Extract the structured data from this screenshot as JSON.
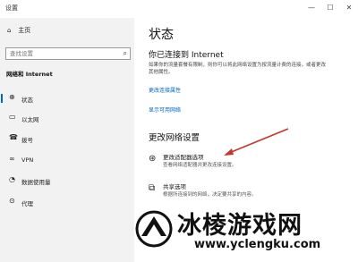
{
  "window": {
    "title": "设置",
    "minimize": "—",
    "maximize": "☐",
    "close": "✕"
  },
  "sidebar": {
    "home": {
      "icon": "home-icon",
      "glyph": "⌂",
      "label": "主页"
    },
    "search": {
      "placeholder": "查找设置",
      "icon": "search-icon",
      "glyph": "⌕"
    },
    "section": "网络和 Internet",
    "items": [
      {
        "icon": "status-icon",
        "glyph": "⊕",
        "label": "状态"
      },
      {
        "icon": "ethernet-icon",
        "glyph": "▭",
        "label": "以太网"
      },
      {
        "icon": "dialup-icon",
        "glyph": "☎",
        "label": "拨号"
      },
      {
        "icon": "vpn-icon",
        "glyph": "∞",
        "label": "VPN"
      },
      {
        "icon": "data-usage-icon",
        "glyph": "◔",
        "label": "数据使用量"
      },
      {
        "icon": "proxy-icon",
        "glyph": "⊙",
        "label": "代理"
      }
    ]
  },
  "main": {
    "title": "状态",
    "connected_heading": "你已连接到 Internet",
    "connected_desc": "如果你的流量套餐有限制，则你可以将此网络设置为按流量计费的连接，或者更改其他属性。",
    "link_properties": "更改连接属性",
    "link_available": "显示可用网络",
    "section_heading": "更改网络设置",
    "options": [
      {
        "icon": "adapter-icon",
        "glyph": "⊛",
        "title": "更改适配器选项",
        "desc": "查看网络适配器并更改连接设置。"
      },
      {
        "icon": "sharing-icon",
        "glyph": "⧉",
        "title": "共享选项",
        "desc": "根据所连接到的网络，决定要共享的内容。"
      }
    ]
  },
  "accent": "#0067c0",
  "arrow_color": "#c0392b",
  "watermark": {
    "title": "冰棱游戏网",
    "url": "www.yclengku.com"
  }
}
